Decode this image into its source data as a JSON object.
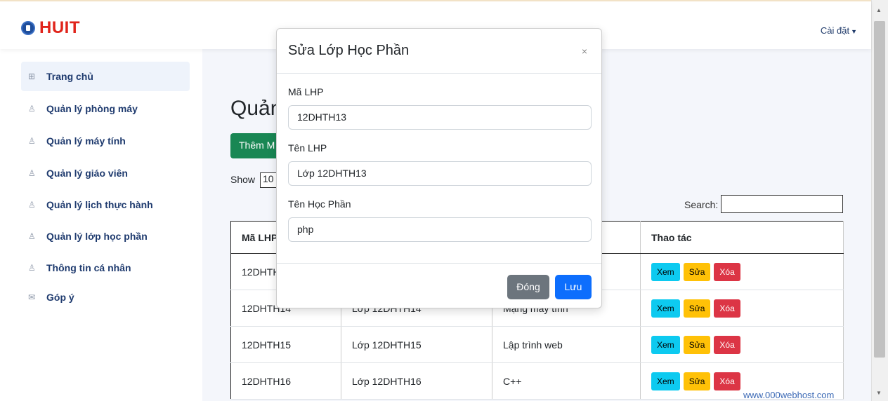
{
  "navbar": {
    "brand": "HUIT",
    "settings_label": "Cài đặt"
  },
  "sidebar": {
    "items": [
      {
        "label": "Trang chủ",
        "icon": "grid-icon"
      },
      {
        "label": "Quản lý phòng máy",
        "icon": "user-icon"
      },
      {
        "label": "Quản lý máy tính",
        "icon": "user-icon"
      },
      {
        "label": "Quản lý giáo viên",
        "icon": "user-icon"
      },
      {
        "label": "Quản lý lịch thực hành",
        "icon": "user-icon"
      },
      {
        "label": "Quản lý lớp học phần",
        "icon": "user-icon"
      },
      {
        "label": "Thông tin cá nhân",
        "icon": "user-icon"
      },
      {
        "label": "Góp ý",
        "icon": "mail-icon"
      }
    ]
  },
  "main": {
    "title": "Quản",
    "add_button": "Thêm M",
    "show_label": "Show",
    "show_value": "10",
    "search_label": "Search:",
    "table": {
      "headers": [
        "Mã LHP",
        "",
        "",
        "Thao tác"
      ],
      "rows": [
        {
          "ma": "12DHTH",
          "ten": "",
          "hp": ""
        },
        {
          "ma": "12DHTH14",
          "ten": "Lớp 12DHTH14",
          "hp": "Mạng máy tính"
        },
        {
          "ma": "12DHTH15",
          "ten": "Lớp 12DHTH15",
          "hp": "Lập trình web"
        },
        {
          "ma": "12DHTH16",
          "ten": "Lớp 12DHTH16",
          "hp": "C++"
        }
      ],
      "actions": {
        "view": "Xem",
        "edit": "Sửa",
        "delete": "Xóa"
      }
    },
    "watermark": "www.000webhost.com"
  },
  "modal": {
    "title": "Sửa Lớp Học Phần",
    "close_symbol": "×",
    "fields": [
      {
        "label": "Mã LHP",
        "value": "12DHTH13"
      },
      {
        "label": "Tên LHP",
        "value": "Lớp 12DHTH13"
      },
      {
        "label": "Tên Học Phần",
        "value": "php"
      }
    ],
    "close_button": "Đóng",
    "save_button": "Lưu"
  }
}
